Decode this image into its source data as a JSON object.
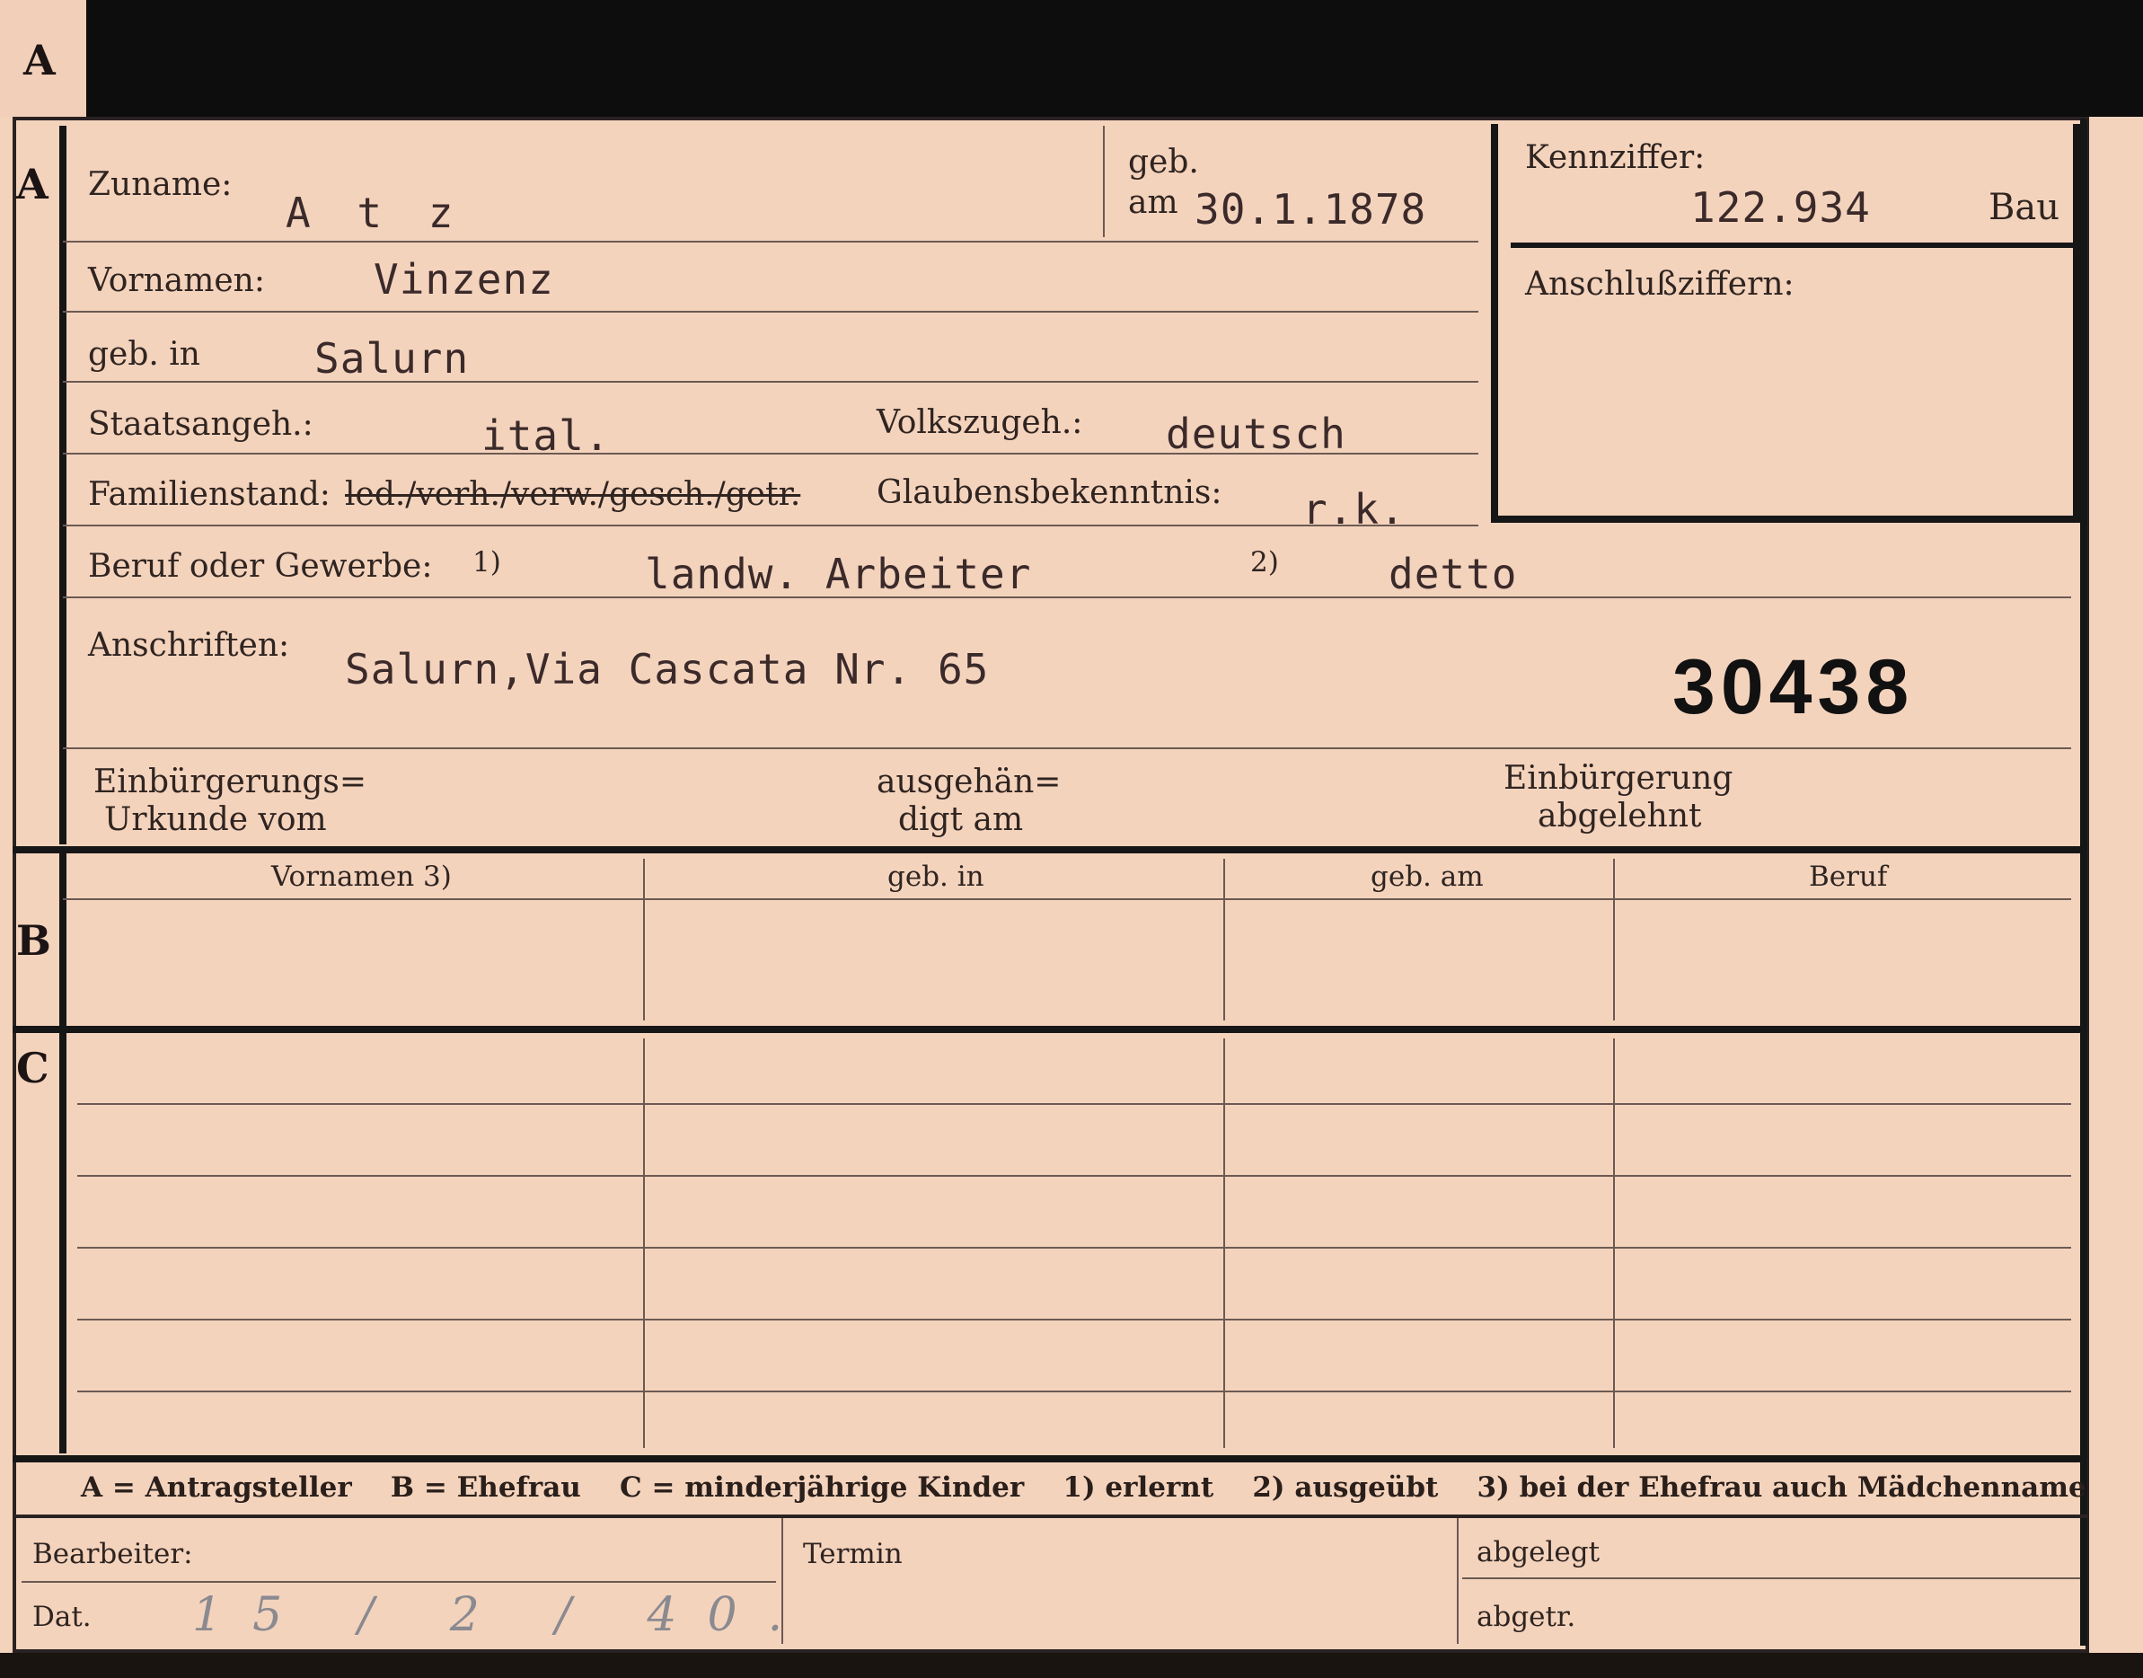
{
  "tab": {
    "letter": "A"
  },
  "section_a": {
    "letter": "A",
    "zuname_label": "Zuname:",
    "zuname_value": "A t z",
    "geb_label_top": "geb.",
    "geb_label_bottom": "am",
    "geb_am_value": "30.1.1878",
    "kennziffer_label": "Kennziffer:",
    "kennziffer_value": "122.934",
    "kennziffer_suffix": "Bau",
    "anschluss_label": "Anschlußziffern:",
    "vornamen_label": "Vornamen:",
    "vornamen_value": "Vinzenz",
    "geb_in_label": "geb. in",
    "geb_in_value": "Salurn",
    "staats_label": "Staatsangeh.:",
    "staats_value": "ital.",
    "volks_label": "Volkszugeh.:",
    "volks_value": "deutsch",
    "familienstand_label": "Familienstand:",
    "familienstand_options": "led./verh./verw./gesch./getr.",
    "glauben_label": "Glaubensbekenntnis:",
    "glauben_value": "r.k.",
    "beruf_label": "Beruf oder Gewerbe:",
    "beruf_mark1": "1)",
    "beruf_value1": "landw. Arbeiter",
    "beruf_mark2": "2)",
    "beruf_value2": "detto",
    "anschriften_label": "Anschriften:",
    "anschriften_value": "Salurn,Via Cascata Nr. 65",
    "stamp_number": "30438",
    "einb_label_1": "Einbürgerungs=",
    "einb_label_2": "Urkunde vom",
    "ausg_label_1": "ausgehän=",
    "ausg_label_2": "digt am",
    "abgel_label_1": "Einbürgerung",
    "abgel_label_2": "abgelehnt"
  },
  "section_b": {
    "letter": "B",
    "headers": [
      "Vornamen 3)",
      "geb. in",
      "geb. am",
      "Beruf"
    ]
  },
  "section_c": {
    "letter": "C"
  },
  "legend": {
    "text": "A = Antragsteller    B = Ehefrau    C = minderjährige Kinder    1) erlernt    2) ausgeübt    3) bei der Ehefrau auch Mädchenname"
  },
  "footer": {
    "bearbeiter_label": "Bearbeiter:",
    "dat_label": "Dat.",
    "dat_value": "15 / 2 / 40.",
    "termin_label": "Termin",
    "abgelegt_label": "abgelegt",
    "abgetr_label": "abgetr."
  },
  "colors": {
    "card": "#f4d3bd",
    "frame": "#161616",
    "ink": "#3b2a2a",
    "pencil": "#8a8a90"
  }
}
